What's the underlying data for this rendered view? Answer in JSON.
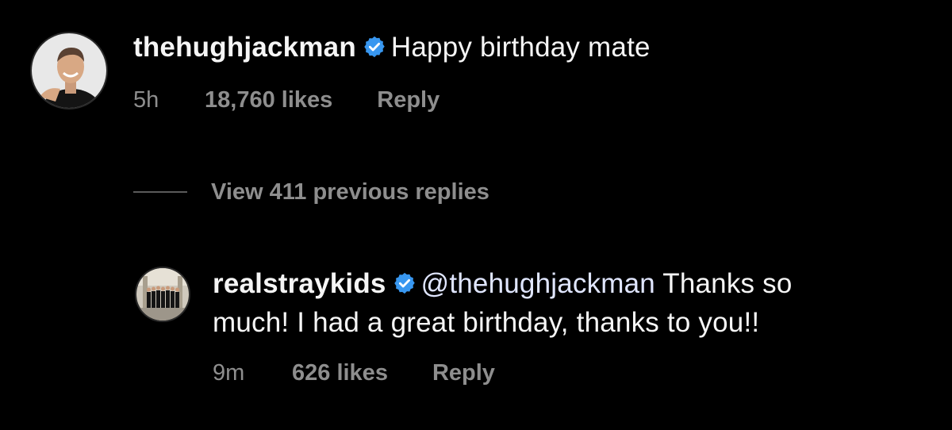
{
  "comments": [
    {
      "username": "thehughjackman",
      "verified": true,
      "text": "Happy birthday mate",
      "time": "5h",
      "likes": "18,760 likes",
      "reply_label": "Reply"
    },
    {
      "username": "realstraykids",
      "verified": true,
      "mention": "@thehughjackman",
      "text_line1": "Thanks so",
      "text_line2": "much! I had a great birthday, thanks to you!!",
      "time": "9m",
      "likes": "626 likes",
      "reply_label": "Reply"
    }
  ],
  "view_replies": {
    "label": "View 411 previous replies"
  },
  "colors": {
    "background": "#000000",
    "verified_badge": "#3897f0",
    "meta_text": "#8e8e8e"
  }
}
